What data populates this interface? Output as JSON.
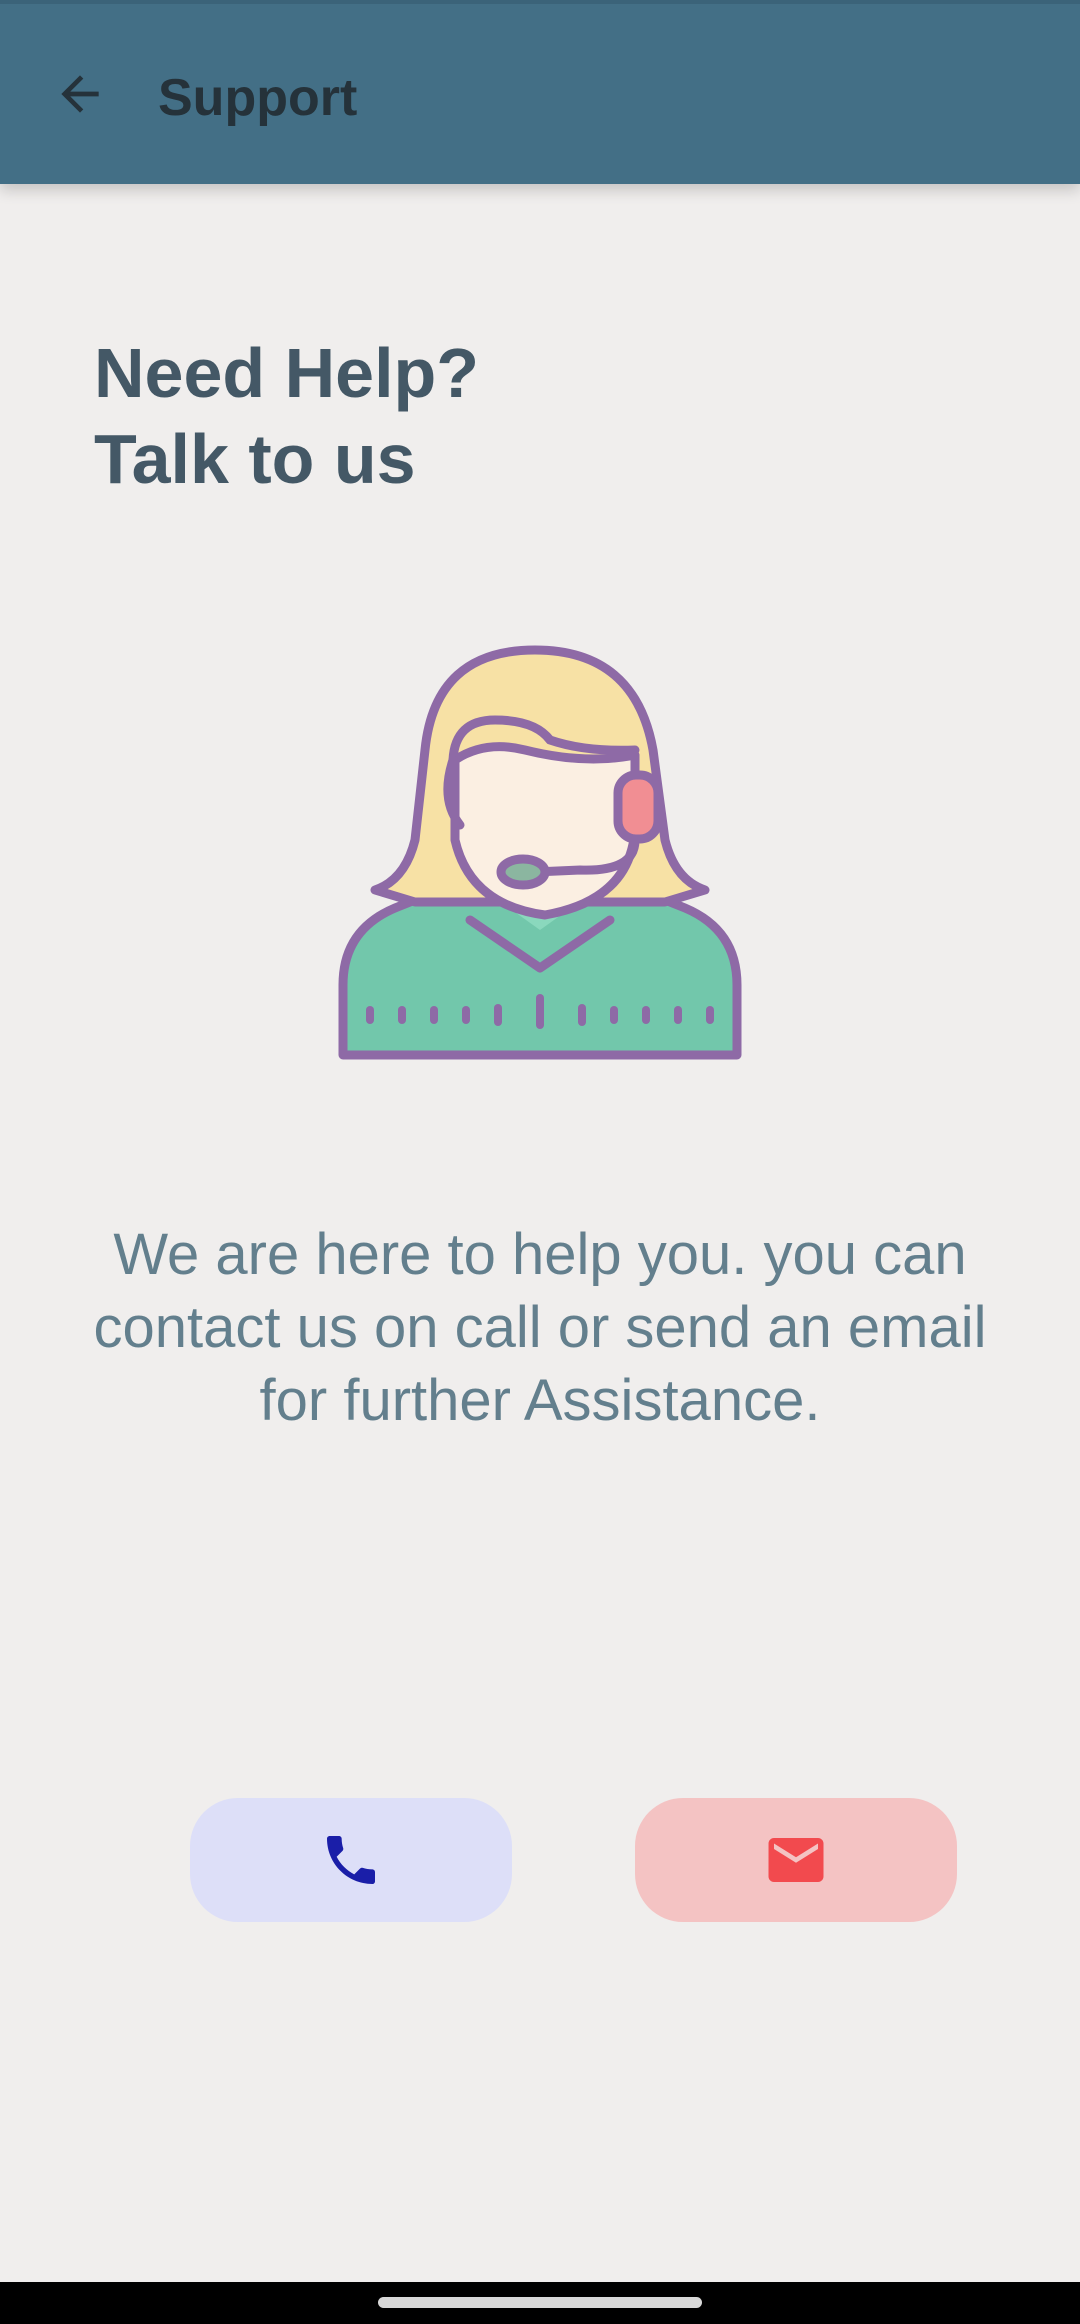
{
  "app_bar": {
    "title": "Support",
    "back_icon": "arrow-back-icon",
    "color": "#436f86"
  },
  "main": {
    "heading_line1": "Need Help?",
    "heading_line2": "Talk to us",
    "illustration": "support-agent-headset-icon",
    "description": "We are here to help you. you can contact us on call or send an email for further Assistance."
  },
  "actions": {
    "call": {
      "icon": "phone-icon",
      "background": "#dddff8",
      "icon_color": "#1a1ea8"
    },
    "email": {
      "icon": "mail-icon",
      "background": "#f4c3c3",
      "icon_color": "#f24a4e"
    }
  }
}
